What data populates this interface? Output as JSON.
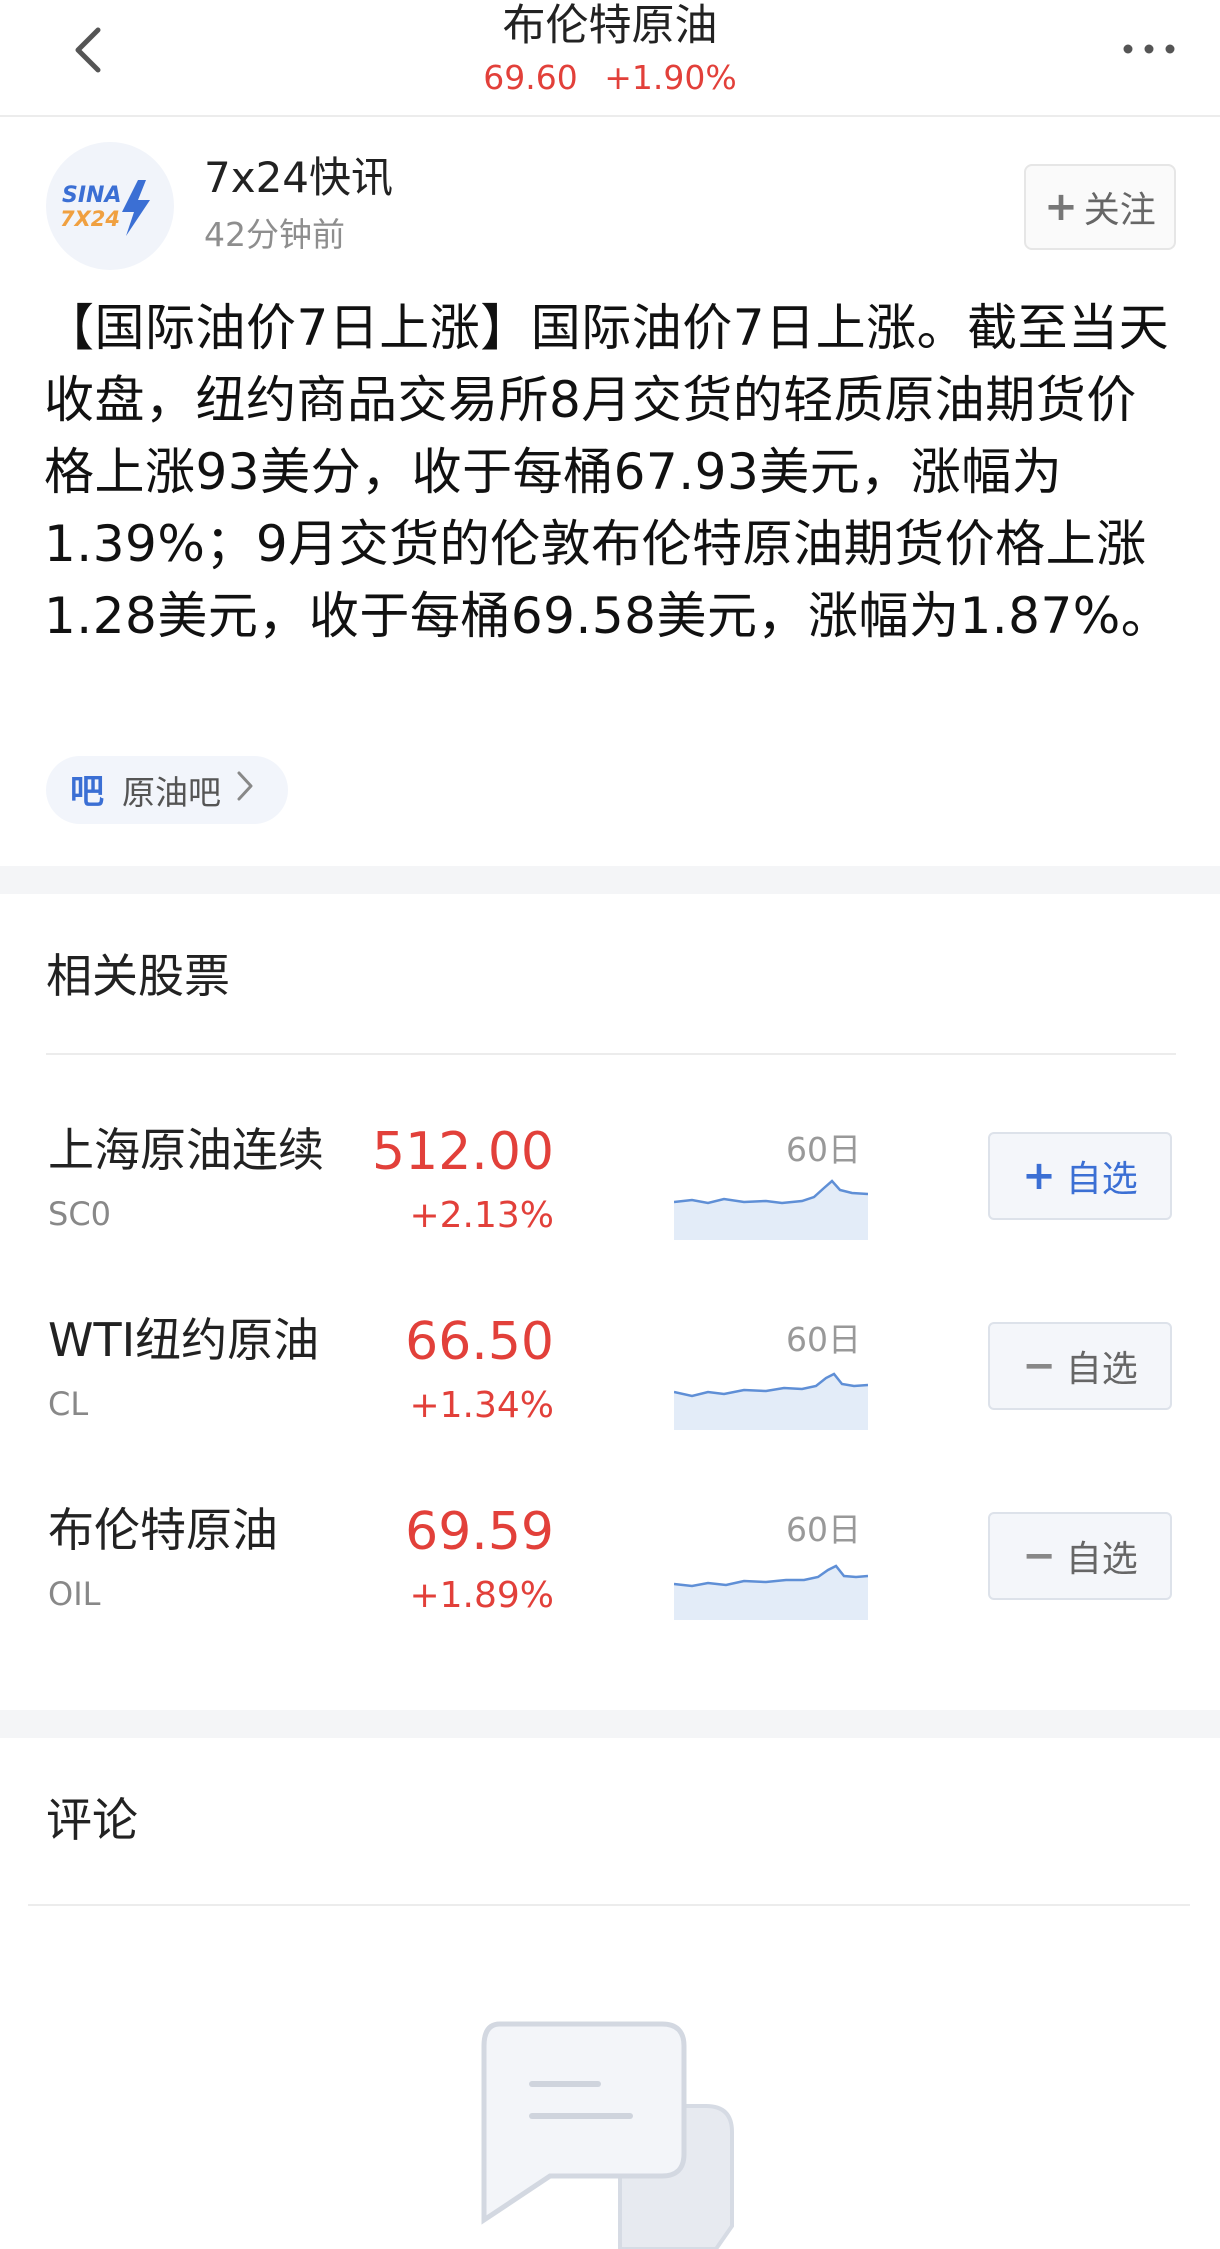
{
  "header": {
    "title": "布伦特原油",
    "price": "69.60",
    "change": "+1.90%"
  },
  "post": {
    "avatar_lines": [
      "SINA",
      "7X24"
    ],
    "author": "7x24快讯",
    "time": "42分钟前",
    "follow_label": "关注",
    "content": "【国际油价7日上涨】国际油价7日上涨。截至当天收盘，纽约商品交易所8月交货的轻质原油期货价格上涨93美分，收于每桶67.93美元，涨幅为1.39%；9月交货的伦敦布伦特原油期货价格上涨1.28美元，收于每桶69.58美元，涨幅为1.87%。",
    "tag": {
      "icon_text": "吧",
      "label": "原油吧"
    }
  },
  "related": {
    "title": "相关股票",
    "stocks": [
      {
        "name": "上海原油连续",
        "code": "SC0",
        "price": "512.00",
        "change": "+2.13%",
        "spark_label": "60日",
        "watch_label": "自选",
        "watch_state": "add",
        "watch_icon": "+"
      },
      {
        "name": "WTI纽约原油",
        "code": "CL",
        "price": "66.50",
        "change": "+1.34%",
        "spark_label": "60日",
        "watch_label": "自选",
        "watch_state": "added",
        "watch_icon": "−"
      },
      {
        "name": "布伦特原油",
        "code": "OIL",
        "price": "69.59",
        "change": "+1.89%",
        "spark_label": "60日",
        "watch_label": "自选",
        "watch_state": "added",
        "watch_icon": "−"
      }
    ]
  },
  "comments": {
    "title": "评论"
  },
  "colors": {
    "up": "#e2403a",
    "accent": "#3b6fd4",
    "spark_line": "#5f8fd6"
  }
}
